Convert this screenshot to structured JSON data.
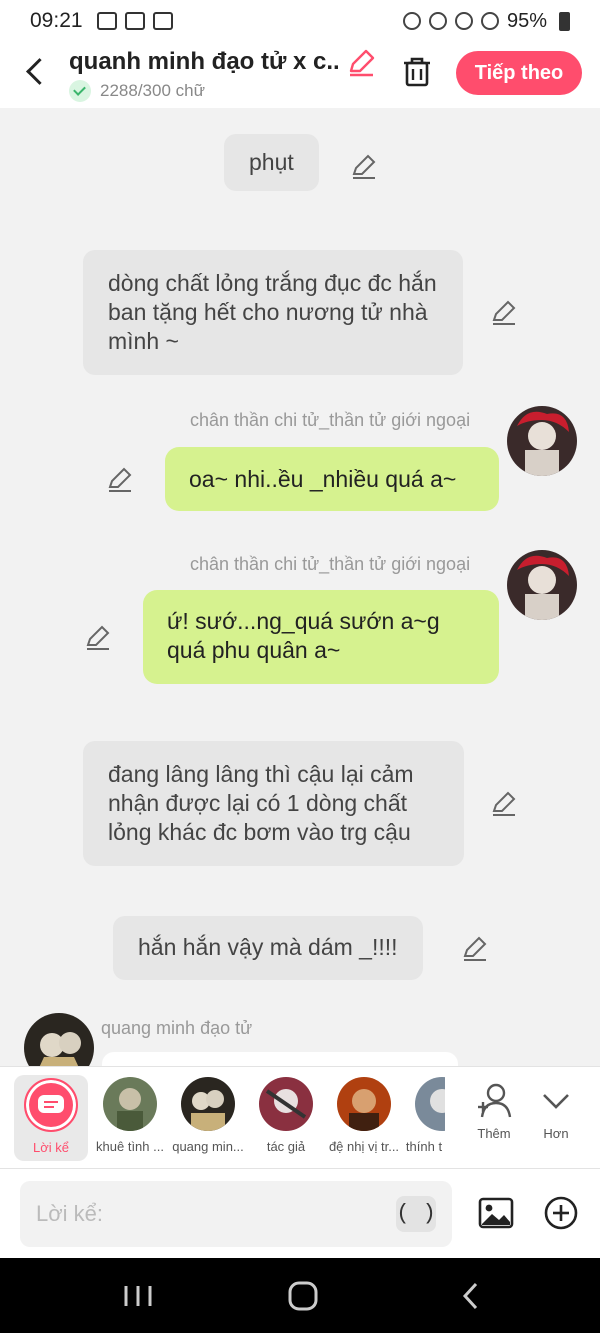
{
  "status_bar": {
    "time": "09:21",
    "battery": "95%"
  },
  "header": {
    "title": "quanh minh đạo tử x c...",
    "word_count": "2288/300 chữ",
    "next_label": "Tiếp theo"
  },
  "messages": [
    {
      "type": "narration",
      "text": "phụt"
    },
    {
      "type": "narration",
      "text": "dòng chất lỏng trắng đục đc hắn ban tặng hết cho nương tử nhà mình ~"
    },
    {
      "type": "dialogue",
      "speaker": "chân thần chi tử_thần tử giới ngoại",
      "text": "oa~ nhi..ều _nhiều quá a~"
    },
    {
      "type": "dialogue",
      "speaker": "chân thần chi tử_thần tử giới ngoại",
      "text": "ứ! sướ...ng_quá sướn a~g quá phu quân a~"
    },
    {
      "type": "narration",
      "text": "đang lâng lâng thì cậu lại cảm nhận được lại có 1 dòng chất lỏng khác đc bơm vào trg cậu"
    },
    {
      "type": "narration",
      "text": "hắn hắn vậy mà dám _!!!!"
    },
    {
      "type": "dialogue_left",
      "speaker": "quang minh đạo tử"
    }
  ],
  "characters": {
    "active_label": "Lời kể",
    "items": [
      "khuê tình ...",
      "quang min...",
      "tác giả",
      "đệ nhị vị tr...",
      "thính t"
    ],
    "more_label": "Thêm",
    "less_label": "Hơn"
  },
  "composer": {
    "placeholder": "Lời kể:",
    "paren": "( )"
  },
  "colors": {
    "accent": "#ff4d6d",
    "dialogue_bubble": "#d6f28f",
    "narration_bubble": "#e6e6e6"
  }
}
